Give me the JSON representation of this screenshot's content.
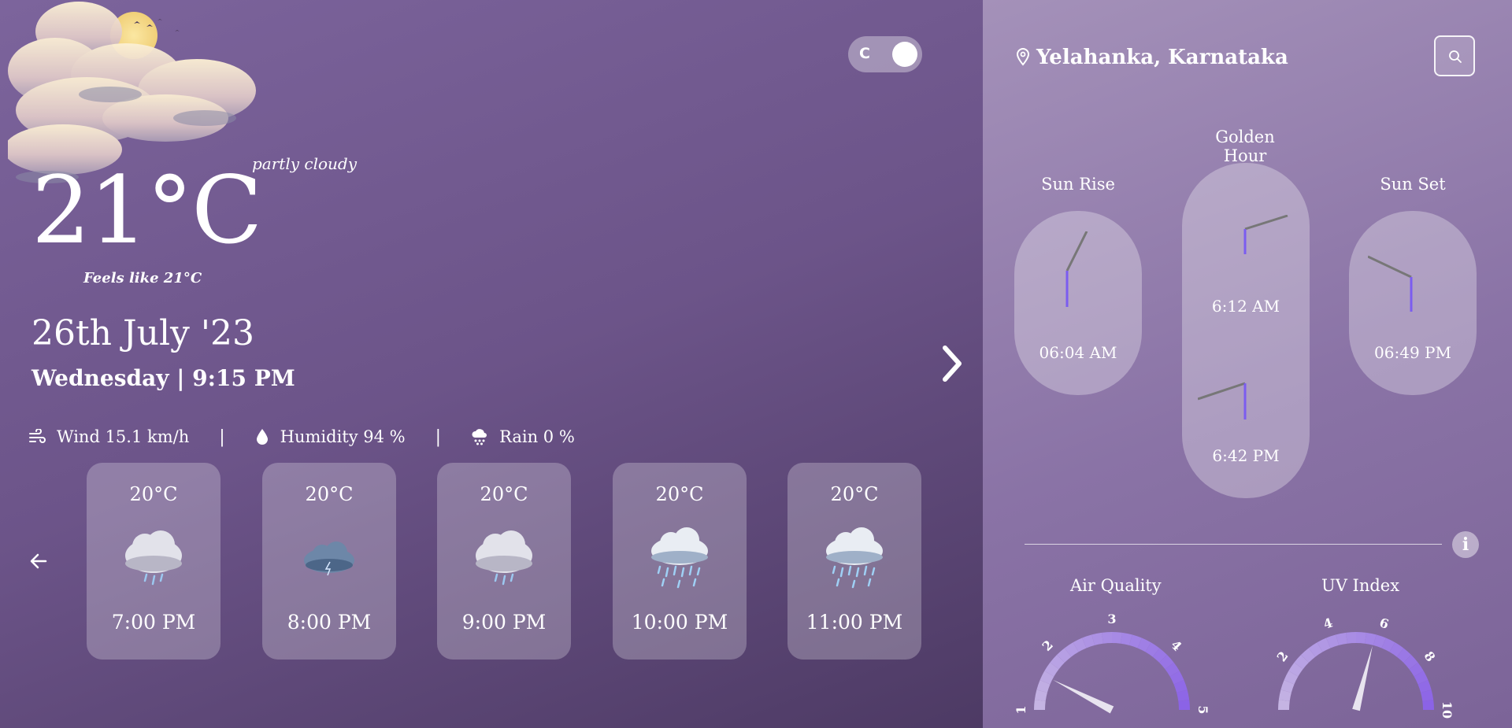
{
  "current": {
    "condition": "partly cloudy",
    "temperature": "21°C",
    "feels_like": "Feels like  21°C",
    "date": "26th July '23",
    "day_time": "Wednesday | 9:15 PM"
  },
  "unit_toggle": {
    "label": "C"
  },
  "stats": {
    "wind": "Wind 15.1 km/h",
    "humidity": "Humidity 94 %",
    "rain": "Rain 0 %",
    "separator": "|"
  },
  "hourly": [
    {
      "temp": "20°C",
      "time": "7:00 PM",
      "icon": "rain-cloud-icon"
    },
    {
      "temp": "20°C",
      "time": "8:00 PM",
      "icon": "storm-cloud-icon"
    },
    {
      "temp": "20°C",
      "time": "9:00 PM",
      "icon": "rain-cloud-icon"
    },
    {
      "temp": "20°C",
      "time": "10:00 PM",
      "icon": "heavy-rain-icon"
    },
    {
      "temp": "20°C",
      "time": "11:00 PM",
      "icon": "heavy-rain-icon"
    }
  ],
  "location": "Yelahanka, Karnataka",
  "sun": {
    "sunrise_title": "Sun Rise",
    "sunrise_time": "06:04 AM",
    "golden_title": "Golden Hour",
    "golden_morning": "6:12 AM",
    "golden_evening": "6:42 PM",
    "sunset_title": "Sun Set",
    "sunset_time": "06:49 PM"
  },
  "info_label": "i",
  "air_quality": {
    "title": "Air Quality",
    "value": 1.6,
    "ticks": [
      "1",
      "2",
      "3",
      "4",
      "5"
    ]
  },
  "uv_index": {
    "title": "UV Index",
    "value": 5.8,
    "ticks": [
      "2",
      "4",
      "6",
      "8",
      "10"
    ]
  },
  "colors": {
    "gauge_track": "#c5b4e3",
    "gauge_active": "#8b63e6",
    "clock_hand": "#7b5cf0"
  }
}
